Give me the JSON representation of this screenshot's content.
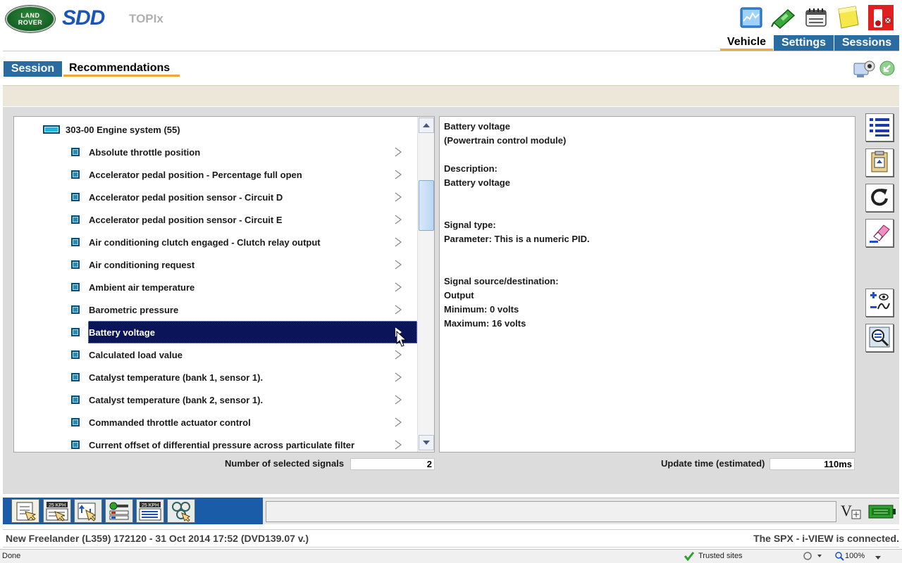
{
  "header": {
    "logo_line1": "LAND",
    "logo_line2": "ROVER",
    "brand": "SDD",
    "subtitle": "TOPIx",
    "toolbar_icons": [
      "datalogger-icon",
      "cable-icon",
      "vci-icon",
      "notes-icon",
      "emergency-stop-icon"
    ]
  },
  "main_tabs": [
    {
      "label": "Vehicle",
      "active": true
    },
    {
      "label": "Settings",
      "active": false
    },
    {
      "label": "Sessions",
      "active": false
    }
  ],
  "sub_tabs": [
    {
      "label": "Session",
      "active": true
    },
    {
      "label": "Recommendations",
      "active": false
    }
  ],
  "tree": {
    "group_label": "303-00 Engine system  (55)",
    "items": [
      {
        "label": "Absolute throttle position",
        "selected": false
      },
      {
        "label": "Accelerator pedal position  -  Percentage full open",
        "selected": false
      },
      {
        "label": "Accelerator pedal position sensor  -  Circuit  D",
        "selected": false
      },
      {
        "label": "Accelerator pedal position sensor  -  Circuit  E",
        "selected": false
      },
      {
        "label": "Air conditioning clutch engaged  -  Clutch relay output",
        "selected": false
      },
      {
        "label": "Air conditioning request",
        "selected": false
      },
      {
        "label": "Ambient air temperature",
        "selected": false
      },
      {
        "label": "Barometric pressure",
        "selected": false
      },
      {
        "label": "Battery voltage",
        "selected": true
      },
      {
        "label": "Calculated load value",
        "selected": false
      },
      {
        "label": "Catalyst temperature (bank 1, sensor 1).",
        "selected": false
      },
      {
        "label": "Catalyst temperature (bank 2, sensor 1).",
        "selected": false
      },
      {
        "label": "Commanded throttle actuator control",
        "selected": false
      },
      {
        "label": "Current offset of differential pressure across particulate filter",
        "selected": false
      }
    ]
  },
  "detail": {
    "title": "Battery voltage",
    "module": "(Powertrain control module)",
    "description_label": "Description:",
    "description": "Battery voltage",
    "signal_type_label": "Signal type:",
    "signal_type": "Parameter: This is a numeric PID.",
    "source_label": "Signal source/destination:",
    "source": "Output",
    "minimum": "Minimum: 0 volts",
    "maximum": "Maximum: 16 volts"
  },
  "side_buttons": [
    "list-icon",
    "clipboard-icon",
    "refresh-icon",
    "eraser-icon",
    "add-watch-icon",
    "search-icon"
  ],
  "footer": {
    "selected_label": "Number of selected signals",
    "selected_value": "2",
    "update_label": "Update time (estimated)",
    "update_value": "110ms"
  },
  "bottom_toolbar": [
    "checklist-icon",
    "gauge-click-icon",
    "signals-icon",
    "module-icon",
    "gauge-icon",
    "network-icon"
  ],
  "status": {
    "vehicle": "New Freelander (L359) 172120 - 31 Oct 2014 17:52 (DVD139.07 v.)",
    "connection": "The SPX - i-VIEW is connected."
  },
  "browser": {
    "done": "Done",
    "zone": "Trusted sites",
    "zoom": "100%"
  }
}
